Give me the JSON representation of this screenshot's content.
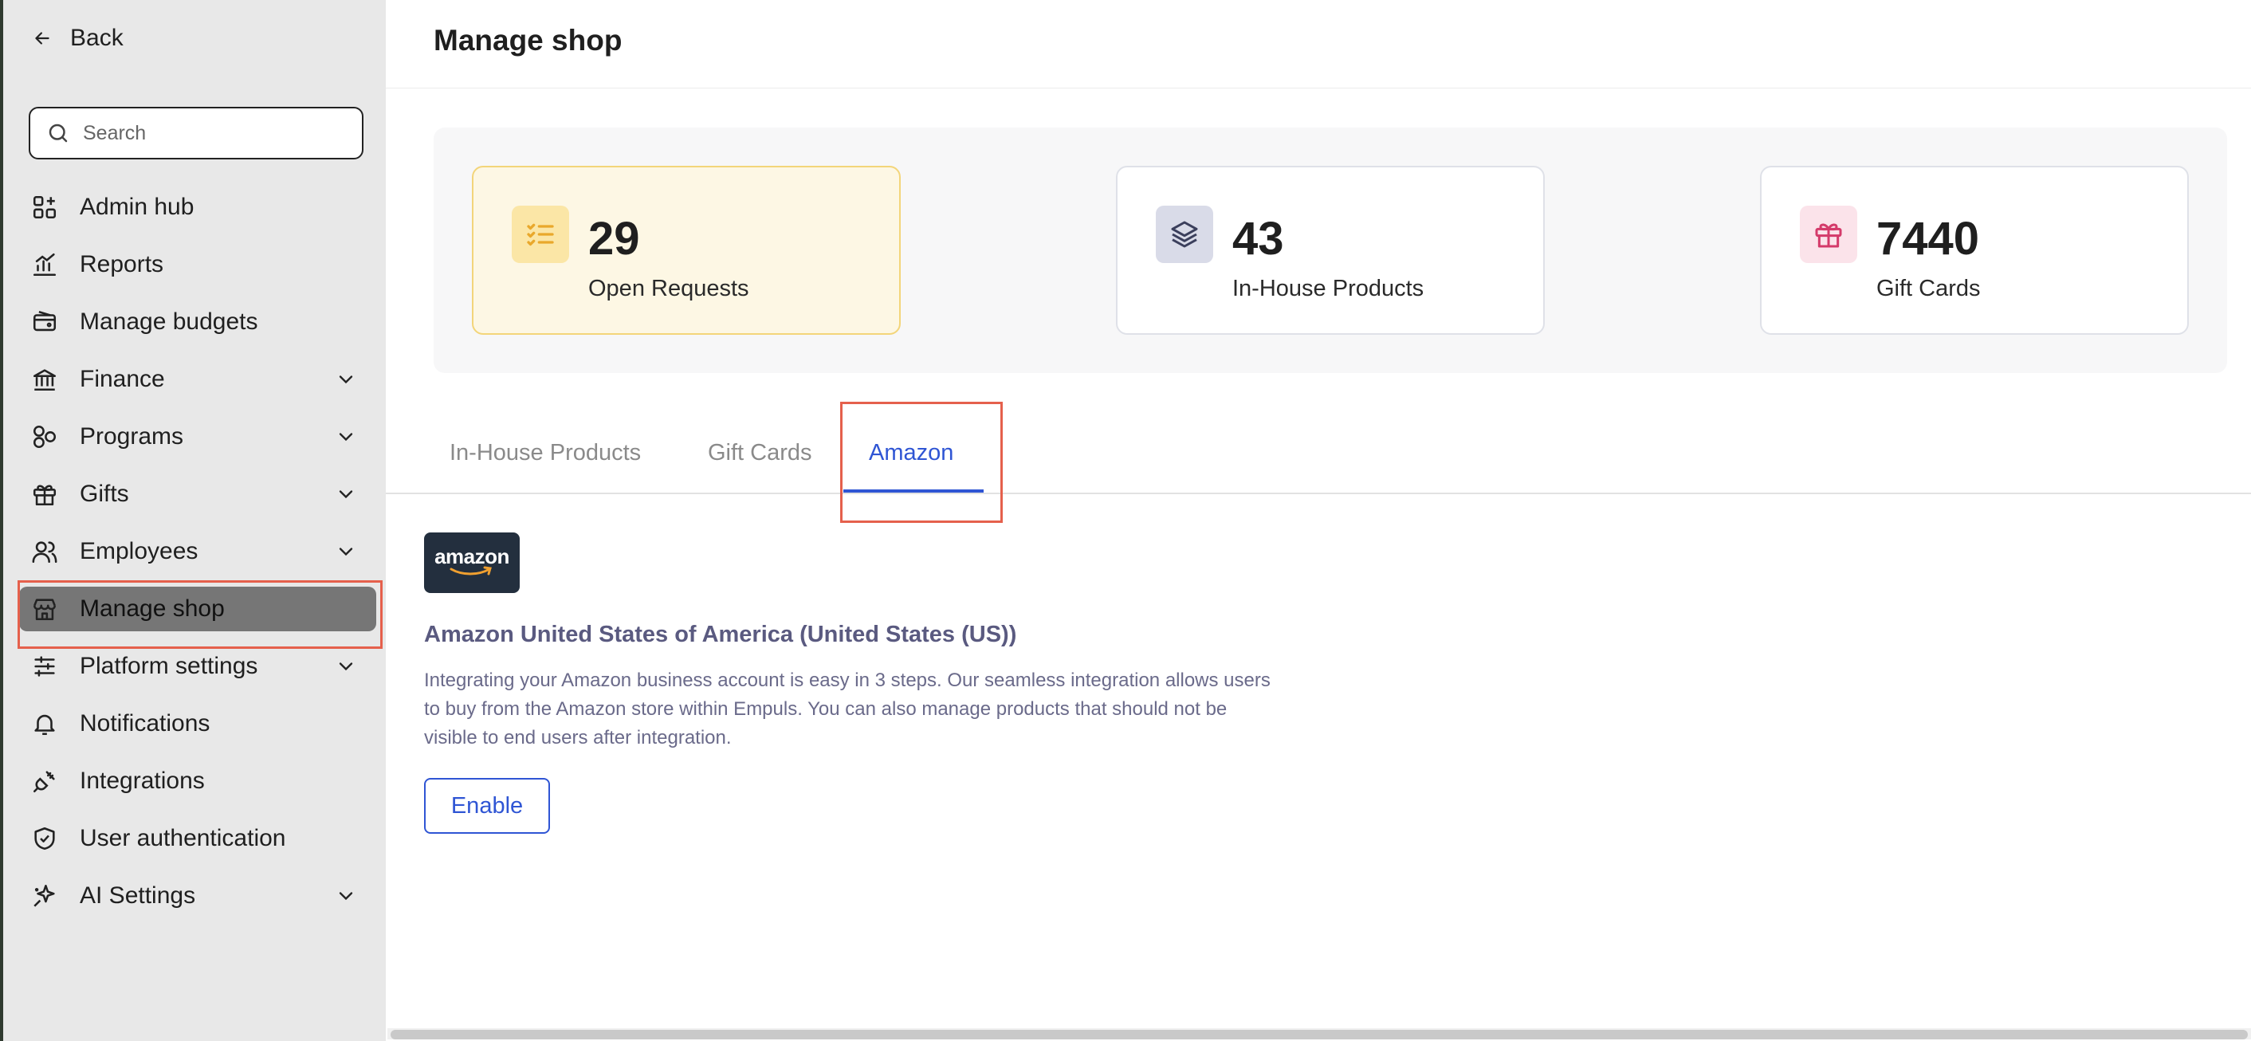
{
  "sidebar": {
    "back_label": "Back",
    "search_placeholder": "Search",
    "items": [
      {
        "label": "Admin hub",
        "icon": "grid-icon",
        "chevron": false
      },
      {
        "label": "Reports",
        "icon": "chart-icon",
        "chevron": false
      },
      {
        "label": "Manage budgets",
        "icon": "wallet-icon",
        "chevron": false
      },
      {
        "label": "Finance",
        "icon": "bank-icon",
        "chevron": true
      },
      {
        "label": "Programs",
        "icon": "shapes-icon",
        "chevron": true
      },
      {
        "label": "Gifts",
        "icon": "gift-icon",
        "chevron": true
      },
      {
        "label": "Employees",
        "icon": "users-icon",
        "chevron": true
      },
      {
        "label": "Manage shop",
        "icon": "store-icon",
        "chevron": false,
        "active": true
      },
      {
        "label": "Platform settings",
        "icon": "sliders-icon",
        "chevron": true
      },
      {
        "label": "Notifications",
        "icon": "bell-icon",
        "chevron": false
      },
      {
        "label": "Integrations",
        "icon": "plug-icon",
        "chevron": false
      },
      {
        "label": "User authentication",
        "icon": "shield-check-icon",
        "chevron": false
      },
      {
        "label": "AI Settings",
        "icon": "sparkle-icon",
        "chevron": true
      }
    ]
  },
  "main": {
    "title": "Manage shop",
    "stats": [
      {
        "value": "29",
        "label": "Open Requests",
        "icon": "checklist-icon",
        "color": "#e9a82b"
      },
      {
        "value": "43",
        "label": "In-House Products",
        "icon": "layers-icon",
        "color": "#3b3f5c"
      },
      {
        "value": "7440",
        "label": "Gift Cards",
        "icon": "gift-icon",
        "color": "#d43a6a"
      }
    ],
    "tabs": [
      {
        "label": "In-House Products",
        "active": false
      },
      {
        "label": "Gift Cards",
        "active": false
      },
      {
        "label": "Amazon",
        "active": true
      }
    ],
    "amazon": {
      "logo_text": "amazon",
      "title": "Amazon United States of America (United States (US))",
      "description": "Integrating your Amazon business account is easy in 3 steps. Our seamless integration allows users to buy from the Amazon store within Empuls. You can also manage products that should not be visible to end users after integration.",
      "enable_label": "Enable"
    }
  },
  "colors": {
    "accent": "#2f55d4",
    "highlight": "#e5604c",
    "sidebar_bg": "#e8e8e8",
    "active_item_bg": "#767676"
  }
}
